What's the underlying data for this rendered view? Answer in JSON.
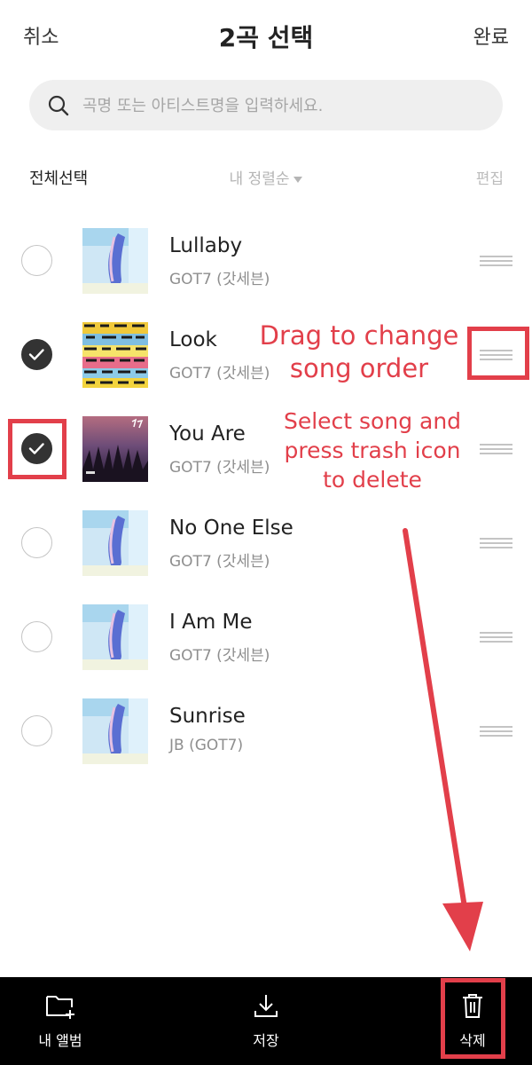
{
  "header": {
    "cancel_label": "취소",
    "title": "2곡 선택",
    "done_label": "완료"
  },
  "search": {
    "placeholder": "곡명 또는 아티스트명을 입력하세요.",
    "icon": "search-icon"
  },
  "toolbar": {
    "select_all_label": "전체선택",
    "sort_label": "내 정렬순",
    "edit_label": "편집"
  },
  "songs": [
    {
      "title": "Lullaby",
      "artist": "GOT7 (갓세븐)",
      "selected": false
    },
    {
      "title": "Look",
      "artist": "GOT7 (갓세븐)",
      "selected": true
    },
    {
      "title": "You Are",
      "artist": "GOT7 (갓세븐)",
      "selected": true
    },
    {
      "title": "No One Else",
      "artist": "GOT7 (갓세븐)",
      "selected": false
    },
    {
      "title": "I Am Me",
      "artist": "GOT7 (갓세븐)",
      "selected": false
    },
    {
      "title": "Sunrise",
      "artist": "JB (GOT7)",
      "selected": false
    }
  ],
  "annotations": {
    "drag": [
      "Drag to change",
      "song order"
    ],
    "select": [
      "Select song and",
      "press trash icon",
      "to delete"
    ],
    "color": "#e23f4a"
  },
  "bottom_bar": {
    "album_label": "내 앨범",
    "save_label": "저장",
    "delete_label": "삭제"
  },
  "colors": {
    "check_on": "#333333",
    "bar_bg": "#000000",
    "search_bg": "#efefef"
  }
}
